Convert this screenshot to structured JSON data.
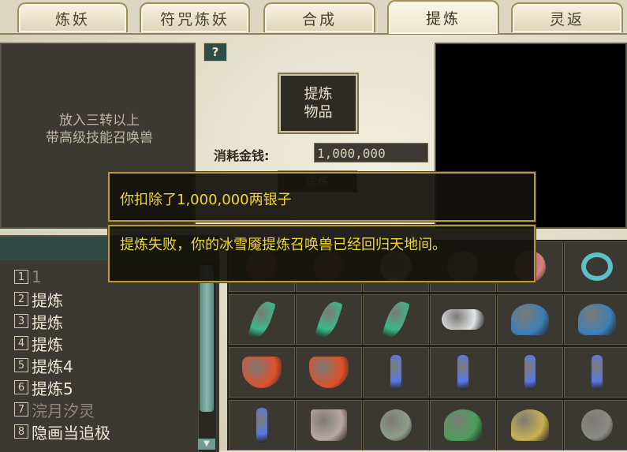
{
  "tabs": [
    {
      "label": "炼妖",
      "active": false
    },
    {
      "label": "符咒炼妖",
      "active": false
    },
    {
      "label": "合成",
      "active": false
    },
    {
      "label": "提炼",
      "active": true
    },
    {
      "label": "灵返",
      "active": false
    }
  ],
  "monster_panel": {
    "hint_line1": "放入三转以上",
    "hint_line2": "带高级技能召唤兽"
  },
  "help_label": "?",
  "item_slot": {
    "line1": "提炼",
    "line2": "物品"
  },
  "cost": {
    "label": "消耗金钱:",
    "value": "1,000,000"
  },
  "refine_button": "提炼",
  "list": {
    "items": [
      {
        "num": "1",
        "label": "1",
        "dim": true
      },
      {
        "num": "2",
        "label": "提炼",
        "dim": false
      },
      {
        "num": "3",
        "label": "提炼",
        "dim": false
      },
      {
        "num": "4",
        "label": "提炼",
        "dim": false
      },
      {
        "num": "5",
        "label": "提炼4",
        "dim": false
      },
      {
        "num": "6",
        "label": "提炼5",
        "dim": false
      },
      {
        "num": "7",
        "label": "浣月汐灵",
        "dim": true
      },
      {
        "num": "8",
        "label": "隐画当追极",
        "dim": false
      }
    ]
  },
  "inventory_icons": [
    [
      "red-orb-icon",
      "red-orb-icon",
      "pearl-icon",
      "gem-icon",
      "potion-icon",
      "ring-icon"
    ],
    [
      "green-feather-icon",
      "green-feather-icon",
      "green-feather-icon",
      "cloud-icon",
      "blue-helmet-icon",
      "blue-helmet-icon"
    ],
    [
      "red-armor-icon",
      "red-armor-icon",
      "blue-necklace-icon",
      "blue-necklace-icon",
      "blue-necklace-icon",
      "blue-necklace-icon"
    ],
    [
      "blue-necklace-icon",
      "cloth-icon",
      "mask-icon",
      "dragon-helmet-icon",
      "warrior-helmet-icon",
      "rock-icon"
    ]
  ],
  "colors": {
    "tooltip_text": "#f0d833",
    "tooltip_border": "#b49c3e"
  },
  "tooltips": {
    "deduct": "你扣除了1,000,000两银子",
    "fail": "提炼失败，你的冰雪魇提炼召唤兽已经回归天地间。"
  }
}
